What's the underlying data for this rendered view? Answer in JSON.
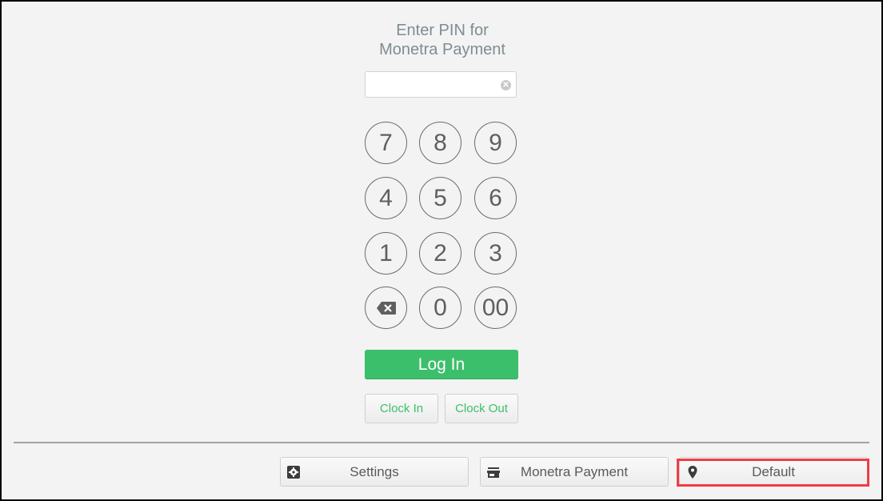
{
  "login_screen": {
    "title_line1": "Enter PIN for",
    "title_line2": "Monetra Payment",
    "pin_input": {
      "value": "",
      "placeholder": ""
    },
    "keypad": {
      "rows": [
        [
          "7",
          "8",
          "9"
        ],
        [
          "4",
          "5",
          "6"
        ],
        [
          "1",
          "2",
          "3"
        ],
        [
          "backspace",
          "0",
          "00"
        ]
      ]
    },
    "login_label": "Log In",
    "clock_in_label": "Clock In",
    "clock_out_label": "Clock Out"
  },
  "footer": {
    "settings_label": "Settings",
    "merchant_label": "Monetra Payment",
    "location_label": "Default"
  },
  "colors": {
    "accent_green": "#3cbf6b",
    "highlight_red": "#f03c43"
  }
}
